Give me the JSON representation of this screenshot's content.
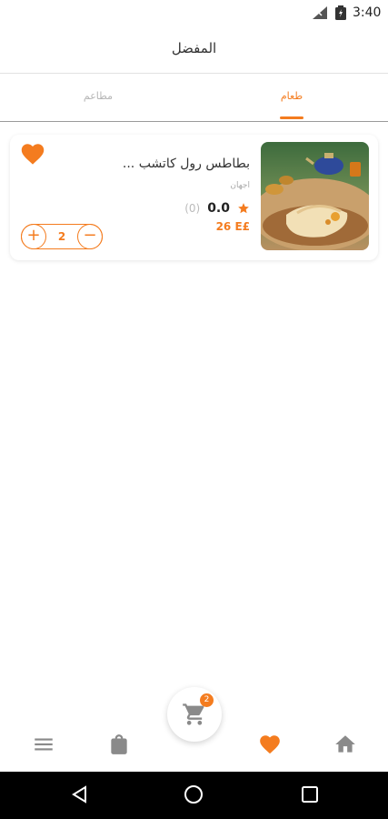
{
  "status_bar": {
    "time": "3:40"
  },
  "header": {
    "title": "المفضل"
  },
  "tabs": [
    {
      "label": "طعام",
      "active": true
    },
    {
      "label": "مطاعم",
      "active": false
    }
  ],
  "favorites": [
    {
      "name": "بطاطس رول كاتشب ...",
      "subtitle": "اجهان",
      "rating": "0.0",
      "rating_count": "(0)",
      "price": "26 E£",
      "quantity": "2",
      "image_icon": "food-photo"
    }
  ],
  "cart": {
    "badge_count": "2",
    "icon": "cart-icon"
  },
  "bottom_nav": [
    {
      "name": "menu",
      "icon": "hamburger-icon"
    },
    {
      "name": "orders",
      "icon": "shopping-bag-icon"
    },
    {
      "name": "favorites",
      "icon": "heart-icon",
      "active": true
    },
    {
      "name": "home",
      "icon": "home-icon"
    }
  ],
  "colors": {
    "accent": "#f47c1f",
    "inactive": "#8a8a8a",
    "text": "#333333"
  }
}
